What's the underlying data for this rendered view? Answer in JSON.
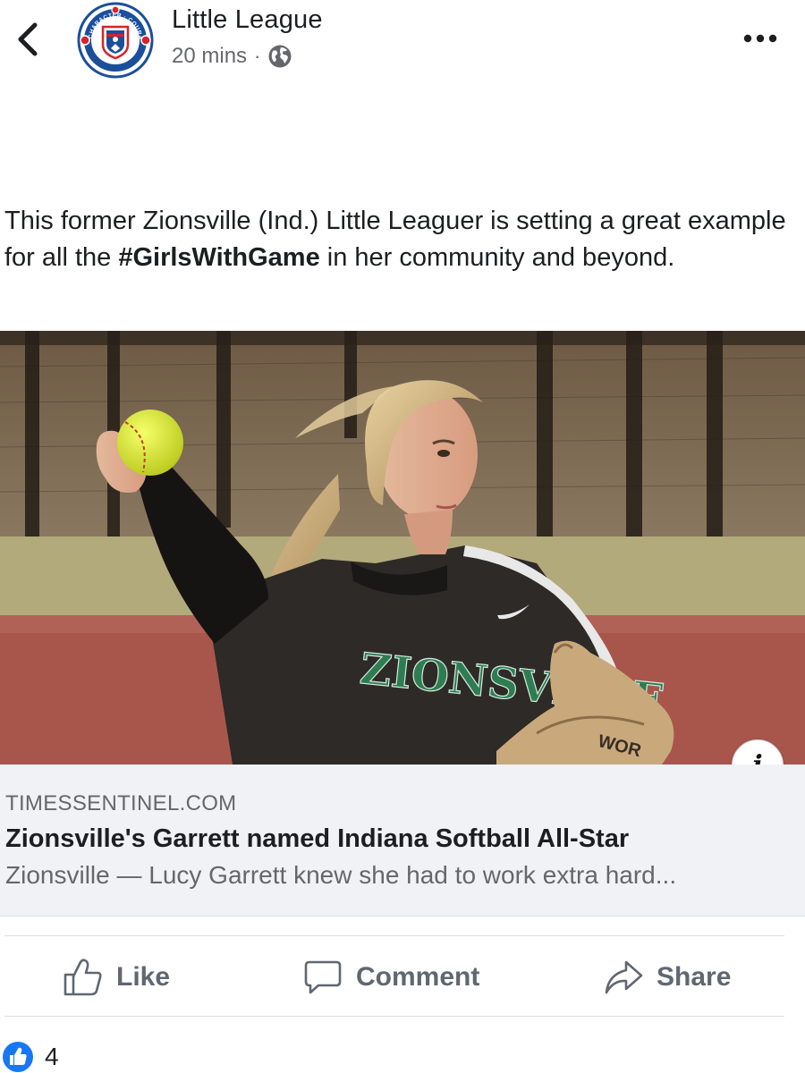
{
  "header": {
    "page_name": "Little League",
    "timestamp": "20 mins",
    "separator": "·",
    "avatar": {
      "logo_text": [
        "CHARACTER",
        "COURAGE",
        "LOYALTY"
      ],
      "colors": {
        "ring": "#1b4f9c",
        "accent": "#d8232a"
      }
    },
    "privacy_icon": "globe-icon"
  },
  "post": {
    "text_before": "This former Zionsville (Ind.) Little Leaguer is setting a great example for all the ",
    "hashtag": "#GirlsWithGame",
    "text_after": " in her community and beyond."
  },
  "link": {
    "image": {
      "jersey_text": "ZIONSVILLE",
      "glove_text": "WOR"
    },
    "domain": "TIMESSENTINEL.COM",
    "title": "Zionsville's Garrett named Indiana Softball All-Star",
    "description": "Zionsville — Lucy Garrett knew she had to work extra hard..."
  },
  "actions": {
    "like_label": "Like",
    "comment_label": "Comment",
    "share_label": "Share"
  },
  "reactions": {
    "count": "4",
    "icon": "thumbs-up-icon",
    "color": "#1877f2"
  }
}
